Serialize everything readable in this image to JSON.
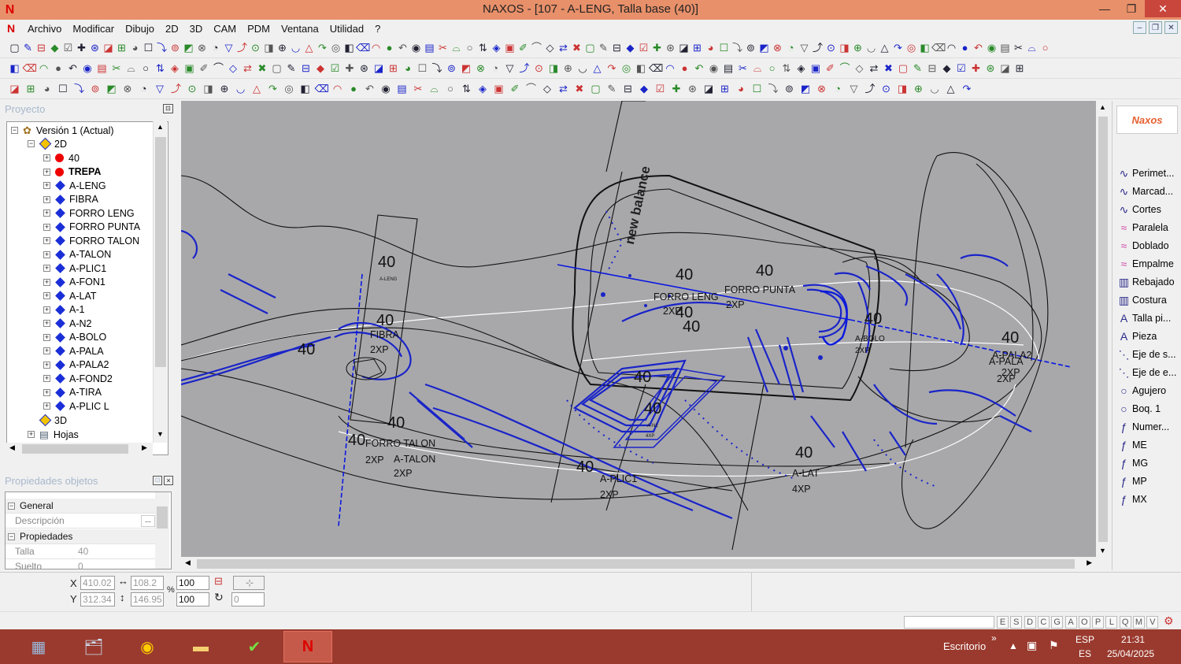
{
  "window": {
    "title": "NAXOS - [107 - A-LENG, Talla base (40)]",
    "app_icon": "N",
    "min": "—",
    "max": "❐",
    "close": "✕"
  },
  "menu": [
    "Archivo",
    "Modificar",
    "Dibujo",
    "2D",
    "3D",
    "CAM",
    "PDM",
    "Ventana",
    "Utilidad",
    "?"
  ],
  "mdi_controls": [
    "–",
    "❐",
    "✕"
  ],
  "project_panel": {
    "title": "Proyecto",
    "pin": "⊡"
  },
  "tree": {
    "root": "Versión 1 (Actual)",
    "group_2d": "2D",
    "layers": [
      {
        "label": "40",
        "marker": "red-dot",
        "bold": false
      },
      {
        "label": "TREPA",
        "marker": "red-dot",
        "bold": true
      },
      {
        "label": "A-LENG",
        "marker": "blue-diamond",
        "bold": false
      },
      {
        "label": "FIBRA",
        "marker": "blue-diamond",
        "bold": false
      },
      {
        "label": "FORRO LENG",
        "marker": "blue-diamond",
        "bold": false
      },
      {
        "label": "FORRO PUNTA",
        "marker": "blue-diamond",
        "bold": false
      },
      {
        "label": "FORRO TALON",
        "marker": "blue-diamond",
        "bold": false
      },
      {
        "label": "A-TALON",
        "marker": "blue-diamond",
        "bold": false
      },
      {
        "label": "A-PLIC1",
        "marker": "blue-diamond",
        "bold": false
      },
      {
        "label": "A-FON1",
        "marker": "blue-diamond",
        "bold": false
      },
      {
        "label": "A-LAT",
        "marker": "blue-diamond",
        "bold": false
      },
      {
        "label": "A-1",
        "marker": "blue-diamond",
        "bold": false
      },
      {
        "label": "A-N2",
        "marker": "blue-diamond",
        "bold": false
      },
      {
        "label": "A-BOLO",
        "marker": "blue-diamond",
        "bold": false
      },
      {
        "label": "A-PALA",
        "marker": "blue-diamond",
        "bold": false
      },
      {
        "label": "A-PALA2",
        "marker": "blue-diamond",
        "bold": false
      },
      {
        "label": "A-FOND2",
        "marker": "blue-diamond",
        "bold": false
      },
      {
        "label": "A-TIRA",
        "marker": "blue-diamond",
        "bold": false
      },
      {
        "label": "A-PLIC L",
        "marker": "blue-diamond",
        "bold": false
      }
    ],
    "group_3d": "3D",
    "group_hojas": "Hojas"
  },
  "properties_panel": {
    "title": "Propiedades objetos",
    "rows": [
      {
        "type": "cat",
        "key": "General"
      },
      {
        "type": "prop",
        "key": "Descripción",
        "value": "",
        "has_button": true
      },
      {
        "type": "cat",
        "key": "Propiedades"
      },
      {
        "type": "prop",
        "key": "Talla",
        "value": "40"
      },
      {
        "type": "prop",
        "key": "Suelto",
        "value": "0"
      }
    ]
  },
  "canvas_labels": [
    {
      "t": "40",
      "cls": "big"
    },
    {
      "t": "A-LENG",
      "cls": "tiny"
    },
    {
      "t": "40",
      "cls": "big"
    },
    {
      "t": "FIBRA",
      "cls": "med"
    },
    {
      "t": "2XP",
      "cls": "med"
    },
    {
      "t": "40",
      "cls": "big"
    },
    {
      "t": "40",
      "cls": "big"
    },
    {
      "t": "FORRO TALON",
      "cls": "med"
    },
    {
      "t": "2XP",
      "cls": "med"
    },
    {
      "t": "A-TALON",
      "cls": "med"
    },
    {
      "t": "2XP",
      "cls": "med"
    },
    {
      "t": "40",
      "cls": "big"
    },
    {
      "t": "40",
      "cls": "big"
    },
    {
      "t": "FORRO LENG",
      "cls": "med"
    },
    {
      "t": "2XP",
      "cls": "med"
    },
    {
      "t": "40",
      "cls": "big"
    },
    {
      "t": "40",
      "cls": "big"
    },
    {
      "t": "40",
      "cls": "big"
    },
    {
      "t": "FORRO PUNTA",
      "cls": "med"
    },
    {
      "t": "2XP",
      "cls": "med"
    },
    {
      "t": "40",
      "cls": "big"
    },
    {
      "t": "A-BOLO",
      "cls": "small"
    },
    {
      "t": "2XP",
      "cls": "small"
    },
    {
      "t": "40",
      "cls": "big"
    },
    {
      "t": "A-PALA2",
      "cls": "med"
    },
    {
      "t": "A-PALA",
      "cls": "med"
    },
    {
      "t": "2XP",
      "cls": "med"
    },
    {
      "t": "2XP",
      "cls": "med"
    },
    {
      "t": "40",
      "cls": "big"
    },
    {
      "t": "40",
      "cls": "big"
    },
    {
      "t": "A-N2",
      "cls": "tiny"
    },
    {
      "t": "4XP",
      "cls": "tiny"
    },
    {
      "t": "40",
      "cls": "big"
    },
    {
      "t": "A-PLIC1",
      "cls": "med"
    },
    {
      "t": "2XP",
      "cls": "med"
    },
    {
      "t": "40",
      "cls": "big"
    },
    {
      "t": "A-LAT",
      "cls": "med"
    },
    {
      "t": "4XP",
      "cls": "med"
    },
    {
      "t": "new balance",
      "cls": "logo"
    }
  ],
  "right_tools": [
    {
      "icon": "∿",
      "label": "Perimet...",
      "pink": false
    },
    {
      "icon": "∿",
      "label": "Marcad...",
      "pink": false
    },
    {
      "icon": "∿",
      "label": "Cortes",
      "pink": false
    },
    {
      "icon": "≈",
      "label": "Paralela",
      "pink": true
    },
    {
      "icon": "≈",
      "label": "Doblado",
      "pink": true
    },
    {
      "icon": "≈",
      "label": "Empalme",
      "pink": true
    },
    {
      "icon": "▥",
      "label": "Rebajado",
      "pink": false
    },
    {
      "icon": "▥",
      "label": "Costura",
      "pink": false
    },
    {
      "icon": "A",
      "label": "Talla pi...",
      "pink": false
    },
    {
      "icon": "A",
      "label": "Pieza",
      "pink": false
    },
    {
      "icon": "⋱",
      "label": "Eje de s...",
      "pink": false
    },
    {
      "icon": "⋱",
      "label": "Eje de e...",
      "pink": false
    },
    {
      "icon": "○",
      "label": "Agujero",
      "pink": false
    },
    {
      "icon": "○",
      "label": "Boq. 1",
      "pink": false
    },
    {
      "icon": "ƒ",
      "label": "Numer...",
      "pink": false
    },
    {
      "icon": "ƒ",
      "label": "ME",
      "pink": false
    },
    {
      "icon": "ƒ",
      "label": "MG",
      "pink": false
    },
    {
      "icon": "ƒ",
      "label": "MP",
      "pink": false
    },
    {
      "icon": "ƒ",
      "label": "MX",
      "pink": false
    }
  ],
  "coords": {
    "x_label": "X",
    "y_label": "Y",
    "x": "410.02",
    "y": "312.34",
    "w": "108.2",
    "h": "146.95",
    "sx": "100",
    "sy": "100",
    "pct": "%",
    "rot": "0"
  },
  "status_keys": [
    "E",
    "S",
    "D",
    "C",
    "G",
    "A",
    "O",
    "P",
    "L",
    "Q",
    "M",
    "V"
  ],
  "taskbar": {
    "desktop": "Escritorio",
    "arrow": "»",
    "lang1": "ESP",
    "lang2": "ES",
    "time": "21:31",
    "date": "25/04/2025"
  }
}
